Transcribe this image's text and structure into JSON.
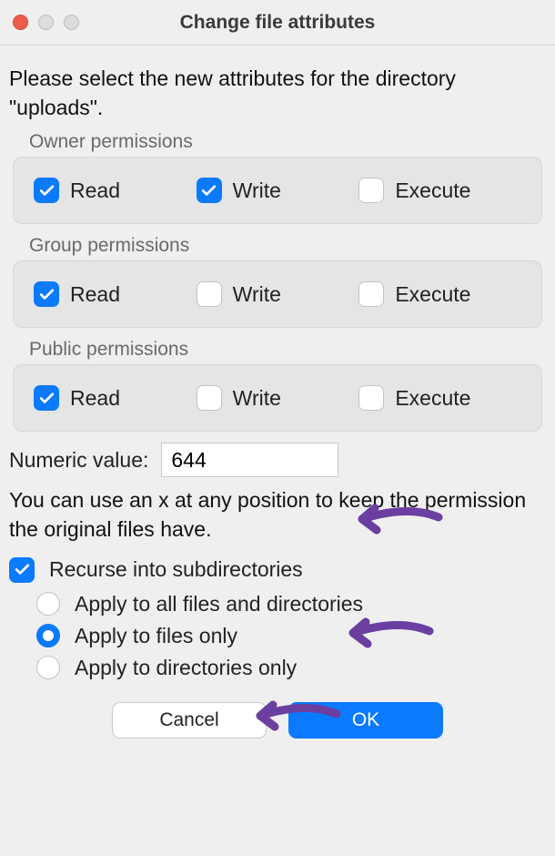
{
  "window": {
    "title": "Change file attributes"
  },
  "intro": "Please select the new attributes for the directory \"uploads\".",
  "sections": {
    "owner": {
      "label": "Owner permissions",
      "read": "Read",
      "write": "Write",
      "execute": "Execute",
      "state": {
        "read": true,
        "write": true,
        "execute": false
      }
    },
    "group": {
      "label": "Group permissions",
      "read": "Read",
      "write": "Write",
      "execute": "Execute",
      "state": {
        "read": true,
        "write": false,
        "execute": false
      }
    },
    "public": {
      "label": "Public permissions",
      "read": "Read",
      "write": "Write",
      "execute": "Execute",
      "state": {
        "read": true,
        "write": false,
        "execute": false
      }
    }
  },
  "numeric": {
    "label": "Numeric value:",
    "value": "644"
  },
  "hint": "You can use an x at any position to keep the permission the original files have.",
  "recurse": {
    "label": "Recurse into subdirectories",
    "checked": true,
    "options": {
      "all": "Apply to all files and directories",
      "files": "Apply to files only",
      "dirs": "Apply to directories only"
    },
    "selected": "files"
  },
  "buttons": {
    "cancel": "Cancel",
    "ok": "OK"
  },
  "annotations": {
    "color": "#6b3fa0"
  }
}
